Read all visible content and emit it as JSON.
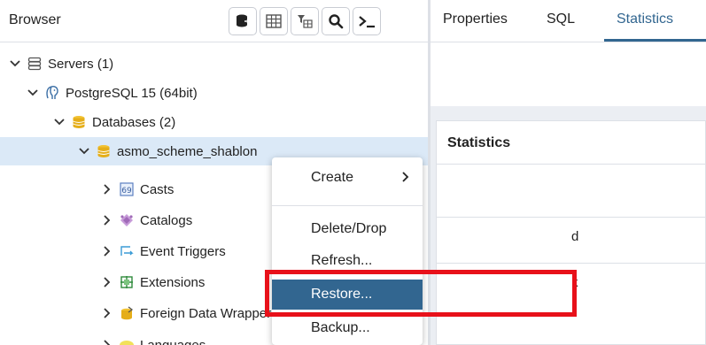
{
  "browser": {
    "title": "Browser",
    "toolbar": [
      "query-tool-icon",
      "table-view-icon",
      "filtered-rows-icon",
      "search-icon",
      "psql-tool-icon"
    ]
  },
  "tree": {
    "servers": "Servers (1)",
    "postgres": "PostgreSQL 15 (64bit)",
    "databases": "Databases (2)",
    "db": "asmo_scheme_shablon",
    "casts": "Casts",
    "catalogs": "Catalogs",
    "event_triggers": "Event Triggers",
    "extensions": "Extensions",
    "foreign_data": "Foreign Data Wrappers",
    "languages": "Languages"
  },
  "tabs": {
    "properties": "Properties",
    "sql": "SQL",
    "statistics": "Statistics"
  },
  "stats": {
    "title": "Statistics",
    "peek1": "d",
    "peek2": "k"
  },
  "context_menu": {
    "create": "Create",
    "delete": "Delete/Drop",
    "refresh": "Refresh...",
    "restore": "Restore...",
    "backup": "Backup..."
  },
  "colors": {
    "accent": "#326690",
    "selection": "#dbe9f7",
    "highlight": "#e8111a"
  }
}
